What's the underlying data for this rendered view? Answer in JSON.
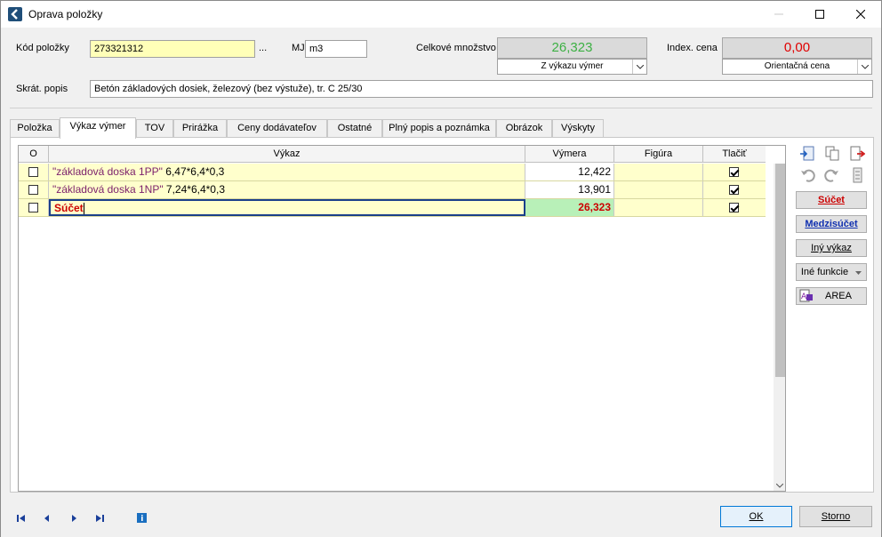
{
  "window": {
    "title": "Oprava položky"
  },
  "form": {
    "kod_label": "Kód položky",
    "kod_value": "273321312",
    "kod_ellipsis": "...",
    "mj_label": "MJ",
    "mj_value": "m3",
    "celkove_label": "Celkové množstvo",
    "celkove_value": "26,323",
    "celkove_combo": "Z výkazu výmer",
    "index_label": "Index. cena",
    "index_value": "0,00",
    "index_combo": "Orientačná cena",
    "skrat_label": "Skrát. popis",
    "skrat_value": "Betón základových dosiek, železový (bez výstuže), tr. C 25/30",
    "celkove_color": "#3cb043",
    "index_color": "#e00000"
  },
  "tabs": [
    {
      "label": "Položka"
    },
    {
      "label": "Výkaz výmer"
    },
    {
      "label": "TOV"
    },
    {
      "label": "Prirážka"
    },
    {
      "label": "Ceny dodávateľov"
    },
    {
      "label": "Ostatné"
    },
    {
      "label": "Plný popis a poznámka"
    },
    {
      "label": "Obrázok"
    },
    {
      "label": "Výskyty"
    }
  ],
  "grid": {
    "headers": {
      "o": "O",
      "vykaz": "Výkaz",
      "vymera": "Výmera",
      "figura": "Figúra",
      "tlacit": "Tlačiť"
    },
    "rows": [
      {
        "string": "\"základová doska 1PP\"",
        "expr": " 6,47*6,4*0,3",
        "vymera": "12,422",
        "figura": "",
        "checked": true
      },
      {
        "string": "\"základová doska 1NP\"",
        "expr": " 7,24*6,4*0,3",
        "vymera": "13,901",
        "figura": "",
        "checked": true
      },
      {
        "string": "",
        "expr": "Súčet",
        "vymera": "26,323",
        "figura": "",
        "checked": true
      }
    ]
  },
  "side": {
    "sucet": "Súčet",
    "medzisucet": "Medzisúčet",
    "iny_vykaz": "Iný výkaz",
    "ine_funkcie": "Iné funkcie",
    "area": "AREA"
  },
  "footer": {
    "ok": "OK",
    "storno": "Storno"
  }
}
